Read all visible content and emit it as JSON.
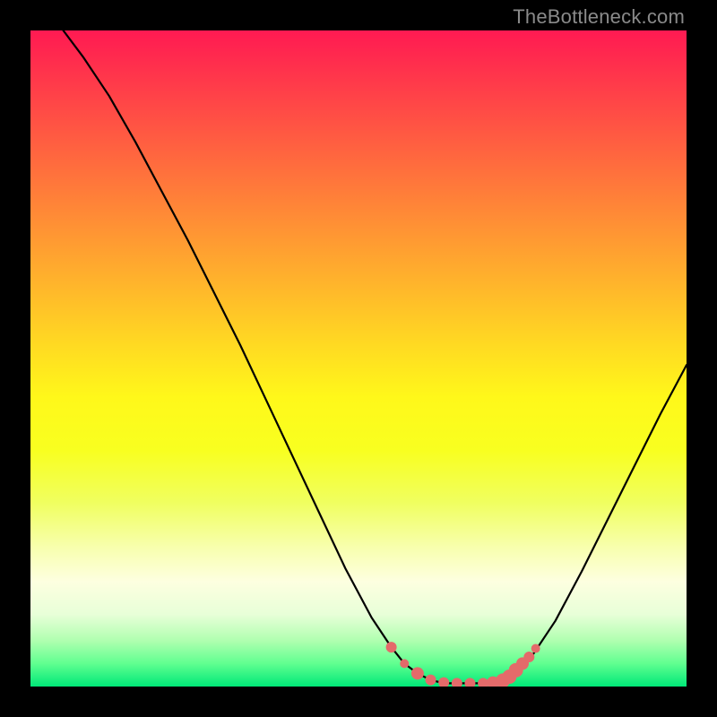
{
  "watermark": "TheBottleneck.com",
  "colors": {
    "curve": "#000000",
    "dots": "#e46a6a",
    "background_top": "#ff1a52",
    "background_bottom": "#00e878"
  },
  "chart_data": {
    "type": "line",
    "title": "",
    "xlabel": "",
    "ylabel": "",
    "xlim": [
      0,
      100
    ],
    "ylim": [
      0,
      100
    ],
    "x": [
      5,
      8,
      12,
      16,
      20,
      24,
      28,
      32,
      36,
      40,
      44,
      48,
      52,
      55,
      57,
      59,
      61,
      63,
      65,
      67,
      69,
      71,
      73,
      76,
      80,
      84,
      88,
      92,
      96,
      100
    ],
    "y": [
      100,
      96,
      90,
      83,
      75.5,
      68,
      60,
      52,
      43.5,
      35,
      26.5,
      18,
      10.5,
      6,
      3.5,
      2,
      1,
      0.5,
      0.5,
      0.5,
      0.5,
      0.7,
      1.5,
      4,
      10,
      17.5,
      25.5,
      33.5,
      41.5,
      49
    ],
    "highlight_points": [
      {
        "x": 55.0,
        "y": 6.0,
        "r": 6
      },
      {
        "x": 57.0,
        "y": 3.5,
        "r": 5
      },
      {
        "x": 59.0,
        "y": 2.0,
        "r": 7
      },
      {
        "x": 61.0,
        "y": 1.0,
        "r": 6
      },
      {
        "x": 63.0,
        "y": 0.6,
        "r": 6
      },
      {
        "x": 65.0,
        "y": 0.5,
        "r": 6
      },
      {
        "x": 67.0,
        "y": 0.5,
        "r": 6
      },
      {
        "x": 69.0,
        "y": 0.5,
        "r": 6
      },
      {
        "x": 70.5,
        "y": 0.6,
        "r": 7
      },
      {
        "x": 72.0,
        "y": 0.9,
        "r": 8
      },
      {
        "x": 73.0,
        "y": 1.5,
        "r": 8
      },
      {
        "x": 74.0,
        "y": 2.5,
        "r": 8
      },
      {
        "x": 75.0,
        "y": 3.5,
        "r": 7
      },
      {
        "x": 76.0,
        "y": 4.5,
        "r": 6
      },
      {
        "x": 77.0,
        "y": 5.8,
        "r": 5
      }
    ]
  }
}
